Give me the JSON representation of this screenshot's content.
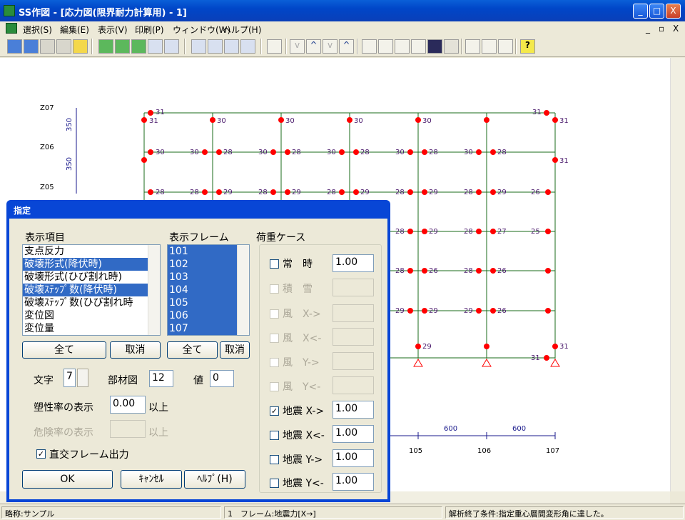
{
  "window": {
    "title": "SS作図 - [応力図(限界耐力計算用) - 1]",
    "min": "_",
    "max": "□",
    "close": "X"
  },
  "menu": {
    "items": [
      "選択(S)",
      "編集(E)",
      "表示(V)",
      "印刷(P)",
      "ウィンドウ(W)",
      "ヘルプ(H)"
    ],
    "mdi": [
      "_",
      "▫",
      "X"
    ]
  },
  "drawing": {
    "levels": [
      "Z07",
      "Z06",
      "Z05"
    ],
    "dims": [
      "350",
      "350"
    ],
    "span_dims": [
      "600",
      "600"
    ],
    "columns": [
      "105",
      "106",
      "107"
    ],
    "values_row1": [
      "31",
      "31",
      "30",
      "30",
      "30",
      "30",
      "31",
      "31"
    ],
    "values_row2": [
      "30",
      "30",
      "28",
      "30",
      "28",
      "30",
      "28",
      "30",
      "28",
      "30",
      "28",
      "31"
    ],
    "values_row3": [
      "28",
      "28",
      "29",
      "28",
      "29",
      "28",
      "29",
      "28",
      "29",
      "28",
      "29",
      "26"
    ],
    "values_right": [
      "28",
      "29",
      "28",
      "27",
      "25",
      "28",
      "26",
      "28",
      "26",
      "29",
      "29",
      "26",
      "29",
      "29",
      "31",
      "31"
    ]
  },
  "dialog": {
    "title": "指定",
    "display_items_label": "表示項目",
    "display_items": [
      "支点反力",
      "破壊形式(降伏時)",
      "破壊形式(ひび割れ時)",
      "破壊ｽﾃｯﾌﾟ数(降伏時)",
      "破壊ｽﾃｯﾌﾟ数(ひび割れ時",
      "変位図",
      "変位量"
    ],
    "frames_label": "表示フレーム",
    "frames": [
      "101",
      "102",
      "103",
      "104",
      "105",
      "106",
      "107"
    ],
    "all_button": "全て",
    "cancel_select": "取消",
    "all_button2": "全て",
    "cancel_select2": "取消",
    "font_label": "文字",
    "font_value": "7",
    "member_label": "部材図",
    "member_value": "12",
    "value_label": "値",
    "value_value": "0",
    "plastic_label": "塑性率の表示",
    "plastic_value": "0.00",
    "plastic_suffix": "以上",
    "danger_label": "危険率の表示",
    "danger_suffix": "以上",
    "ortho_label": "直交フレーム出力",
    "ok": "OK",
    "cancel": "ｷｬﾝｾﾙ",
    "help": "ﾍﾙﾌﾟ(H)",
    "load_cases_label": "荷重ケース",
    "load_cases": [
      {
        "label": "常　時",
        "value": "1.00",
        "checked": false,
        "enabled": true
      },
      {
        "label": "積　雪",
        "value": "",
        "checked": false,
        "enabled": false
      },
      {
        "label": "風　X->",
        "value": "",
        "checked": false,
        "enabled": false
      },
      {
        "label": "風　X<-",
        "value": "",
        "checked": false,
        "enabled": false
      },
      {
        "label": "風　Y->",
        "value": "",
        "checked": false,
        "enabled": false
      },
      {
        "label": "風　Y<-",
        "value": "",
        "checked": false,
        "enabled": false
      },
      {
        "label": "地震 X->",
        "value": "1.00",
        "checked": true,
        "enabled": true
      },
      {
        "label": "地震 X<-",
        "value": "1.00",
        "checked": false,
        "enabled": true
      },
      {
        "label": "地震 Y->",
        "value": "1.00",
        "checked": false,
        "enabled": true
      },
      {
        "label": "地震 Y<-",
        "value": "1.00",
        "checked": false,
        "enabled": true
      }
    ]
  },
  "status": {
    "left": "略称:サンプル",
    "mid": "1　フレーム:地震力[X→]",
    "right": "解析終了条件:指定重心層間変形角に達した。"
  },
  "colors": {
    "titlebar": "#0a5fd8",
    "selection": "#316ac5",
    "member": "#1a6b1a",
    "node": "#ff0000",
    "dim": "#1a1a8c"
  }
}
